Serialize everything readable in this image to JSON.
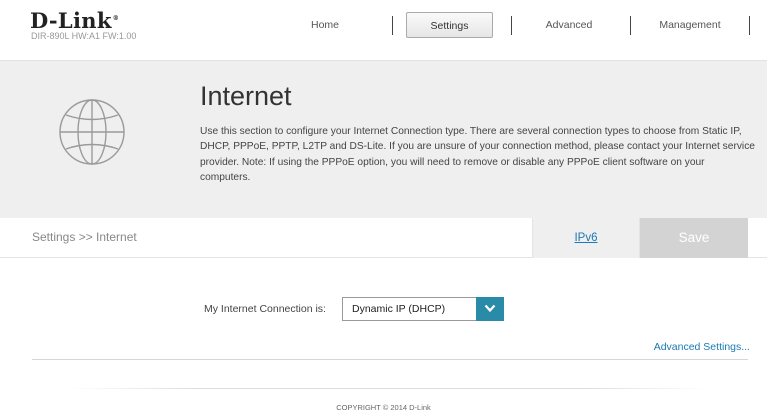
{
  "header": {
    "logo": "D-Link",
    "device_info": "DIR-890L  HW:A1  FW:1.00",
    "nav": [
      {
        "label": "Home"
      },
      {
        "label": "Settings"
      },
      {
        "label": "Advanced"
      },
      {
        "label": "Management"
      }
    ],
    "active_nav": "Settings"
  },
  "banner": {
    "icon": "globe-icon",
    "title": "Internet",
    "description": "Use this section to configure your Internet Connection type. There are several connection types to choose from Static IP, DHCP, PPPoE, PPTP, L2TP and DS-Lite. If you are unsure of your connection method, please contact your Internet service provider. Note: If using the PPPoE option, you will need to remove or disable any PPPoE client software on your computers."
  },
  "toolbar": {
    "breadcrumb": "Settings >> Internet",
    "ipv6_label": "IPv6",
    "save_label": "Save"
  },
  "form": {
    "connection_label": "My Internet Connection is:",
    "connection_value": "Dynamic IP (DHCP)",
    "advanced_link": "Advanced Settings..."
  },
  "footer": {
    "copyright": "COPYRIGHT © 2014 D-Link"
  },
  "colors": {
    "accent": "#2a8ba8",
    "link": "#1a7ab5",
    "banner_bg": "#efefef",
    "save_disabled": "#d3d3d3"
  }
}
